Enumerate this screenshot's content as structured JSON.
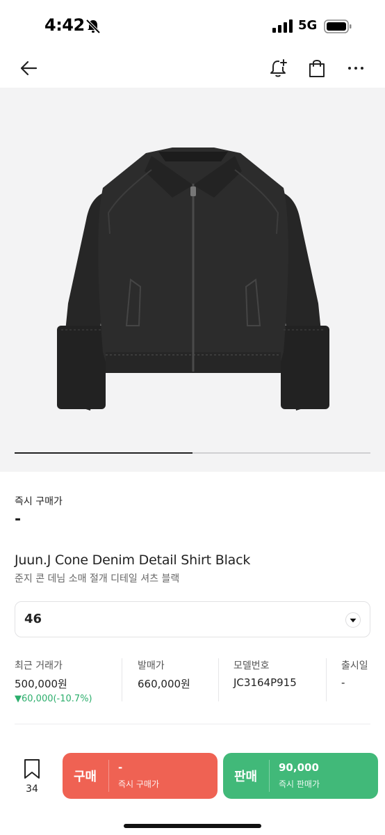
{
  "status_bar": {
    "time": "4:42",
    "network": "5G",
    "icons": [
      "bell-slash-icon",
      "signal-icon",
      "battery-icon"
    ]
  },
  "nav": {
    "icons": [
      "back-arrow-icon",
      "bell-plus-icon",
      "shopping-bag-icon",
      "more-icon"
    ]
  },
  "gallery": {
    "image_subject": "black denim jacket",
    "progress": 0.5
  },
  "price": {
    "label": "즉시 구매가",
    "value": "-"
  },
  "product": {
    "title_en": "Juun.J Cone Denim Detail Shirt Black",
    "title_ko": "준지 콘 데님 소매 절개 디테일 셔츠 블랙"
  },
  "size": {
    "selected": "46"
  },
  "info": {
    "recent": {
      "label": "최근 거래가",
      "value": "500,000원",
      "change": "▼60,000(-10.7%)"
    },
    "release_price": {
      "label": "발매가",
      "value": "660,000원"
    },
    "model": {
      "label": "모델번호",
      "value": "JC3164P915"
    },
    "release_date": {
      "label": "출시일",
      "value": "-"
    }
  },
  "bottom": {
    "wish_count": "34",
    "buy": {
      "label": "구매",
      "price": "-",
      "sub": "즉시 구매가"
    },
    "sell": {
      "label": "판매",
      "price": "90,000",
      "sub": "즉시 판매가"
    }
  },
  "colors": {
    "buy": "#ef6253",
    "sell": "#41b979",
    "price_drop": "#2cae6c"
  }
}
